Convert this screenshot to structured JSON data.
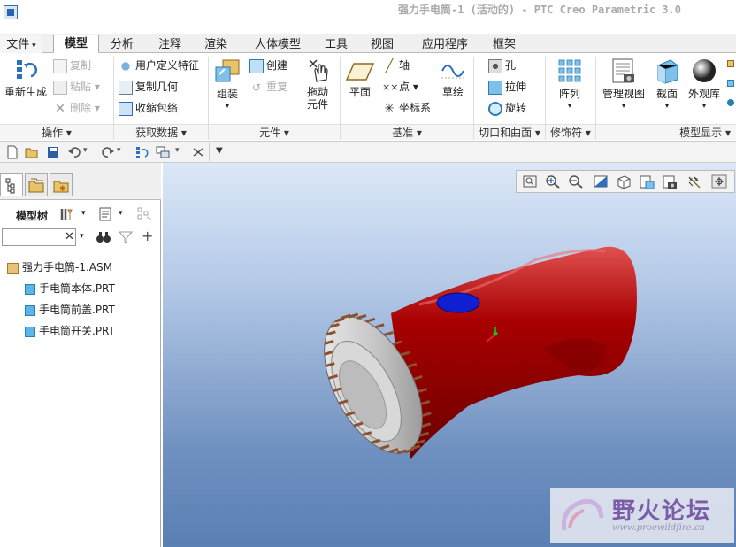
{
  "window": {
    "title": "强力手电筒-1 (活动的) - PTC Creo Parametric 3.0"
  },
  "tabs": [
    "文件",
    "模型",
    "分析",
    "注释",
    "渲染",
    "人体模型",
    "工具",
    "视图",
    "应用程序",
    "框架"
  ],
  "active_tab": "模型",
  "ribbon": {
    "operations": {
      "regen": "重新生成",
      "copy": "复制",
      "paste": "粘贴",
      "delete": "删除",
      "label": "操作"
    },
    "get_data": {
      "udf": "用户定义特征",
      "copy_geom": "复制几何",
      "shrinkwrap": "收缩包络",
      "label": "获取数据"
    },
    "component": {
      "assemble": "组装",
      "create": "创建",
      "repeat": "重复",
      "drag": "拖动元件",
      "label": "元件"
    },
    "datum": {
      "plane": "平面",
      "axis": "轴",
      "point": "点",
      "csys": "坐标系",
      "sketch": "草绘",
      "label": "基准"
    },
    "cut_surface": {
      "hole": "孔",
      "extrude": "拉伸",
      "revolve": "旋转",
      "label": "切口和曲面"
    },
    "modifiers": {
      "pattern": "阵列",
      "label": "修饰符"
    },
    "model_display": {
      "manage_views": "管理视图",
      "section": "截面",
      "appearance": "外观库",
      "label": "模型显示"
    }
  },
  "model_tree": {
    "title": "模型树",
    "search_placeholder": "",
    "items": [
      {
        "name": "强力手电筒-1.ASM",
        "type": "asm"
      },
      {
        "name": "手电筒本体.PRT",
        "type": "prt"
      },
      {
        "name": "手电筒前盖.PRT",
        "type": "prt"
      },
      {
        "name": "手电筒开关.PRT",
        "type": "prt"
      }
    ]
  },
  "watermark": {
    "title": "野火论坛",
    "url": "www.proewildfire.cn"
  },
  "colors": {
    "body_red": "#a80000",
    "switch_blue": "#1020d0",
    "ring_gray": "#b8b8b8",
    "grip_brown": "#8a5030"
  }
}
